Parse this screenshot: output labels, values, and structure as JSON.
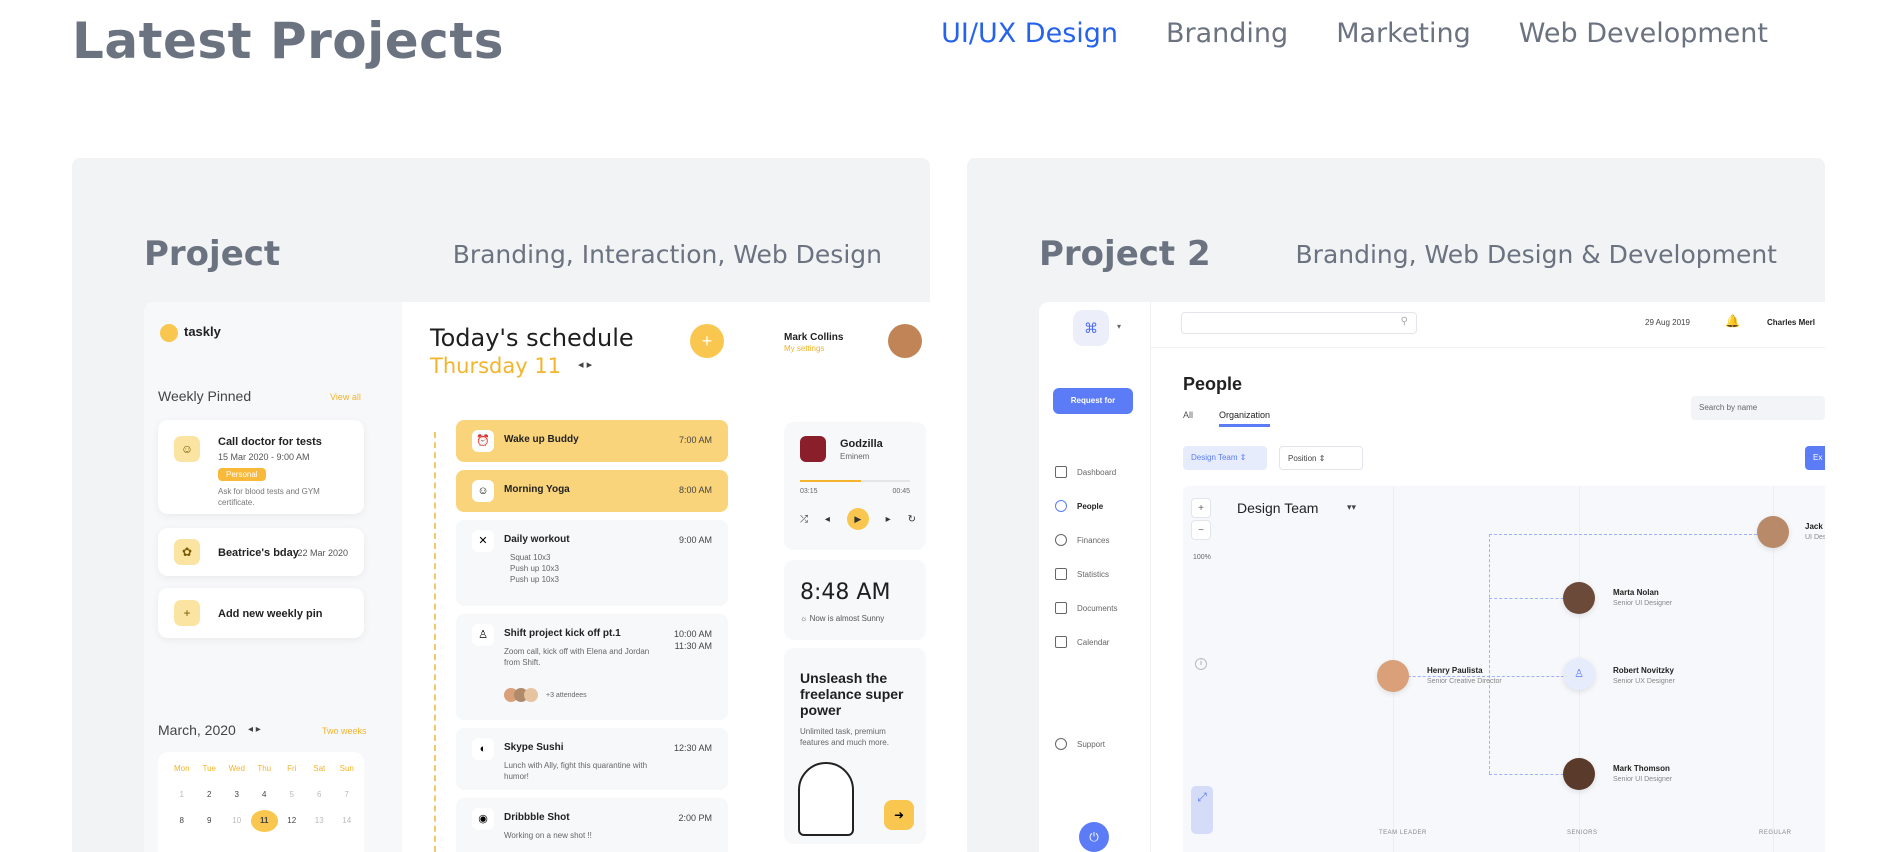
{
  "header": {
    "title": "Latest Projects",
    "filters": [
      "UI/UX Design",
      "Branding",
      "Marketing",
      "Web Development"
    ],
    "active_filter": "UI/UX Design"
  },
  "colors": {
    "accent": "#2563eb",
    "muted": "#6b7280",
    "taskly_yellow": "#f9c74f",
    "people_blue": "#5b7cf6"
  },
  "projects": [
    {
      "title": "Project",
      "tags": "Branding, Interaction, Web Design",
      "app": {
        "logo": "taskly",
        "weekly_pinned": "Weekly Pinned",
        "view_all": "View all",
        "pins": [
          {
            "title": "Call doctor for tests",
            "subtitle": "15 Mar 2020 - 9:00 AM",
            "badge": "Personal",
            "note": "Ask for blood tests and GYM certificate."
          },
          {
            "title": "Beatrice's bday",
            "date": "22 Mar 2020"
          },
          {
            "title": "Add new weekly pin"
          }
        ],
        "calendar_title": "March, 2020",
        "two_weeks": "Two weeks",
        "weekdays": [
          "Mon",
          "Tue",
          "Wed",
          "Thu",
          "Fri",
          "Sat",
          "Sun"
        ],
        "week1": [
          "1",
          "2",
          "3",
          "4",
          "5",
          "6",
          "7"
        ],
        "week2": [
          "8",
          "9",
          "10",
          "11",
          "12",
          "13",
          "14"
        ],
        "selected_day": "11",
        "schedule_title": "Today's schedule",
        "schedule_day": "Thursday 11",
        "tasks": [
          {
            "title": "Wake up Buddy",
            "time": "7:00 AM"
          },
          {
            "title": "Morning Yoga",
            "time": "8:00 AM"
          },
          {
            "title": "Daily workout",
            "time": "9:00 AM",
            "items": [
              "Squat 10x3",
              "Push up 10x3",
              "Push up 10x3"
            ]
          },
          {
            "title": "Shift project kick off pt.1",
            "time": "10:00 AM",
            "time2": "11:30 AM",
            "desc": "Zoom call, kick off with Elena and Jordan from Shift.",
            "attendees": "+3 attendees"
          },
          {
            "title": "Skype Sushi",
            "time": "12:30 AM",
            "desc": "Lunch with Ally, fight this quarantine with humor!"
          },
          {
            "title": "Dribbble Shot",
            "time": "2:00 PM",
            "desc": "Working on a new shot !!"
          }
        ],
        "user_name": "Mark Collins",
        "user_settings": "My settings",
        "player": {
          "song": "Godzilla",
          "artist": "Eminem",
          "elapsed": "03:15",
          "remaining": "00:45",
          "progress": 0.55
        },
        "clock": {
          "time": "8:48 AM",
          "weather": "Now is almost Sunny"
        },
        "promo": {
          "title": "Unsleash the freelance super power",
          "subtitle": "Unlimited task, premium features and much more."
        }
      }
    },
    {
      "title": "Project 2",
      "tags": "Branding, Web Design & Development",
      "app": {
        "request_btn": "Request for",
        "nav": [
          "Dashboard",
          "People",
          "Finances",
          "Statistics",
          "Documents",
          "Calendar"
        ],
        "nav_active": "People",
        "support": "Support",
        "date": "29 Aug 2019",
        "user": "Charles Merl",
        "page_title": "People",
        "tabs": [
          "All",
          "Organization"
        ],
        "active_tab": "Organization",
        "search_placeholder": "Search by name",
        "select_team": "Design Team",
        "select_position": "Position",
        "export_btn": "Ex",
        "zoom": "100%",
        "team_title": "Design Team",
        "people": [
          {
            "name": "Henry Paulista",
            "role": "Senior Creative Director"
          },
          {
            "name": "Marta Nolan",
            "role": "Senior UI Designer"
          },
          {
            "name": "Robert Novitzky",
            "role": "Senior UX Designer"
          },
          {
            "name": "Mark Thomson",
            "role": "Senior UI Designer"
          },
          {
            "name": "Jack Mar",
            "role": "UI Designe"
          }
        ],
        "columns": [
          "TEAM LEADER",
          "SENIORS",
          "REGULAR"
        ]
      }
    }
  ]
}
